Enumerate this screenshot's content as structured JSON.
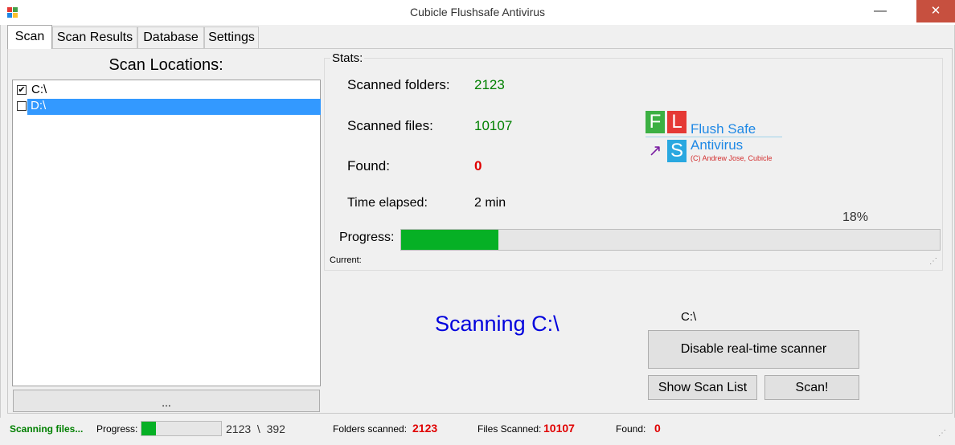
{
  "window": {
    "title": "Cubicle Flushsafe Antivirus",
    "minimize": "—",
    "close": "✕"
  },
  "tabs": [
    {
      "label": "Scan"
    },
    {
      "label": "Scan Results"
    },
    {
      "label": "Database"
    },
    {
      "label": "Settings"
    }
  ],
  "locations": {
    "title": "Scan Locations:",
    "items": [
      {
        "label": "C:\\",
        "checked": true,
        "check_mark": "✔"
      },
      {
        "label": "D:\\",
        "checked": false,
        "check_mark": ""
      }
    ],
    "browse_label": "..."
  },
  "stats": {
    "group_label": "Stats:",
    "scanned_folders_label": "Scanned folders:",
    "scanned_folders_value": "2123",
    "scanned_files_label": "Scanned files:",
    "scanned_files_value": "10107",
    "found_label": "Found:",
    "found_value": "0",
    "time_label": "Time elapsed:",
    "time_value": "2 min",
    "progress_label": "Progress:",
    "progress_text": "18%",
    "progress_fraction": 0.18,
    "current_label": "Current:",
    "colors": {
      "ok": "#008000",
      "alert": "#e00000",
      "progress": "#06b025"
    }
  },
  "logo": {
    "tile_f": "F",
    "tile_l": "L",
    "tile_arrow": "↗",
    "tile_s": "S",
    "line1": "Flush Safe",
    "line2": "Antivirus",
    "line3": "(C) Andrew Jose, Cubicle"
  },
  "scanning": {
    "status_text": "Scanning C:\\",
    "current_path": "C:\\",
    "disable_label": "Disable real-time scanner",
    "show_list_label": "Show Scan List",
    "scan_label": "Scan!"
  },
  "statusbar": {
    "status": "Scanning files...",
    "progress_label": "Progress:",
    "progress_fraction": 0.18,
    "progress_counts": "2123  \\  392",
    "folders_label": "Folders scanned:",
    "folders_value": "2123",
    "files_label": "Files Scanned:",
    "files_value": "10107",
    "found_label": "Found:",
    "found_value": "0"
  }
}
